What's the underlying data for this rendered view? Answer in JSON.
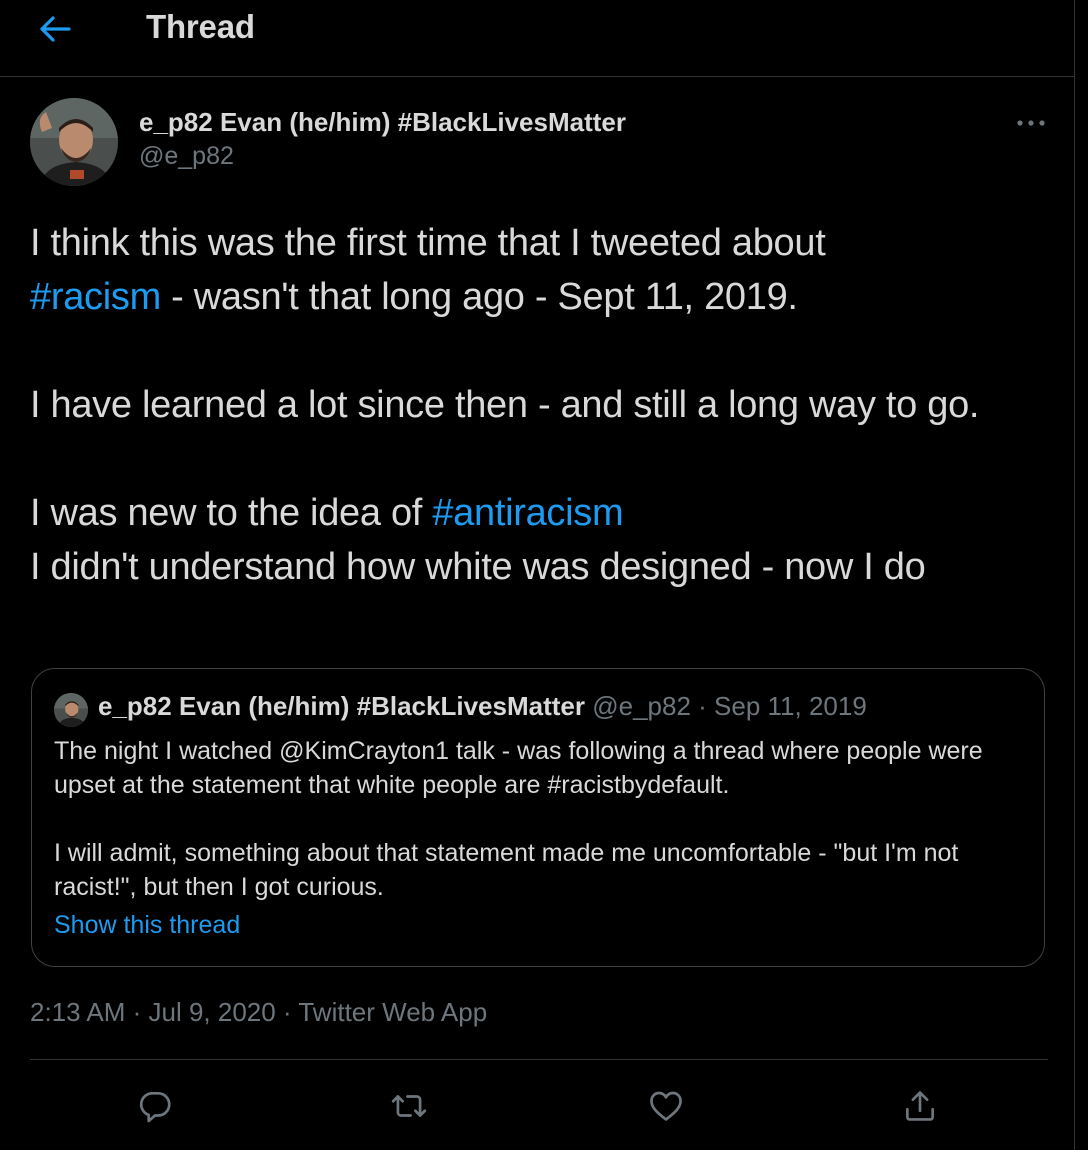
{
  "header": {
    "back_icon": "arrow-left-icon",
    "title": "Thread"
  },
  "tweet": {
    "author": {
      "name": "e_p82 Evan (he/him) #BlackLivesMatter",
      "handle": "@e_p82"
    },
    "more_icon": "more-horizontal-icon",
    "text": {
      "p1_line1": "I think this was the first time that I tweeted about",
      "p1_hashtag": "#racism",
      "p1_rest": " - wasn't that long ago - Sept 11, 2019.",
      "p2": "I have learned a lot since then - and still a long way to go.",
      "p3_prefix": "I was new to the idea of ",
      "p3_hashtag": "#antiracism",
      "p4": "I didn't understand how white was designed - now I do"
    },
    "quote": {
      "author_name": "e_p82 Evan (he/him) #BlackLivesMatter",
      "meta": "@e_p82 · Sep 11, 2019",
      "p1": "The night I watched @KimCrayton1 talk - was following a thread where people were upset at the statement that white people are #racistbydefault.",
      "p2": "I will admit, something about that statement made me uncomfortable - \"but I'm not racist!\", but then I got curious.",
      "show_thread": "Show this thread"
    },
    "timestamp": "2:13 AM · Jul 9, 2020 · Twitter Web App"
  },
  "actions": [
    {
      "icon": "reply-icon"
    },
    {
      "icon": "retweet-icon"
    },
    {
      "icon": "like-icon"
    },
    {
      "icon": "share-icon"
    }
  ],
  "colors": {
    "background": "#000000",
    "text": "#d9d9d9",
    "secondary": "#6e767d",
    "accent": "#1d9bf0",
    "border": "#2f3336"
  }
}
